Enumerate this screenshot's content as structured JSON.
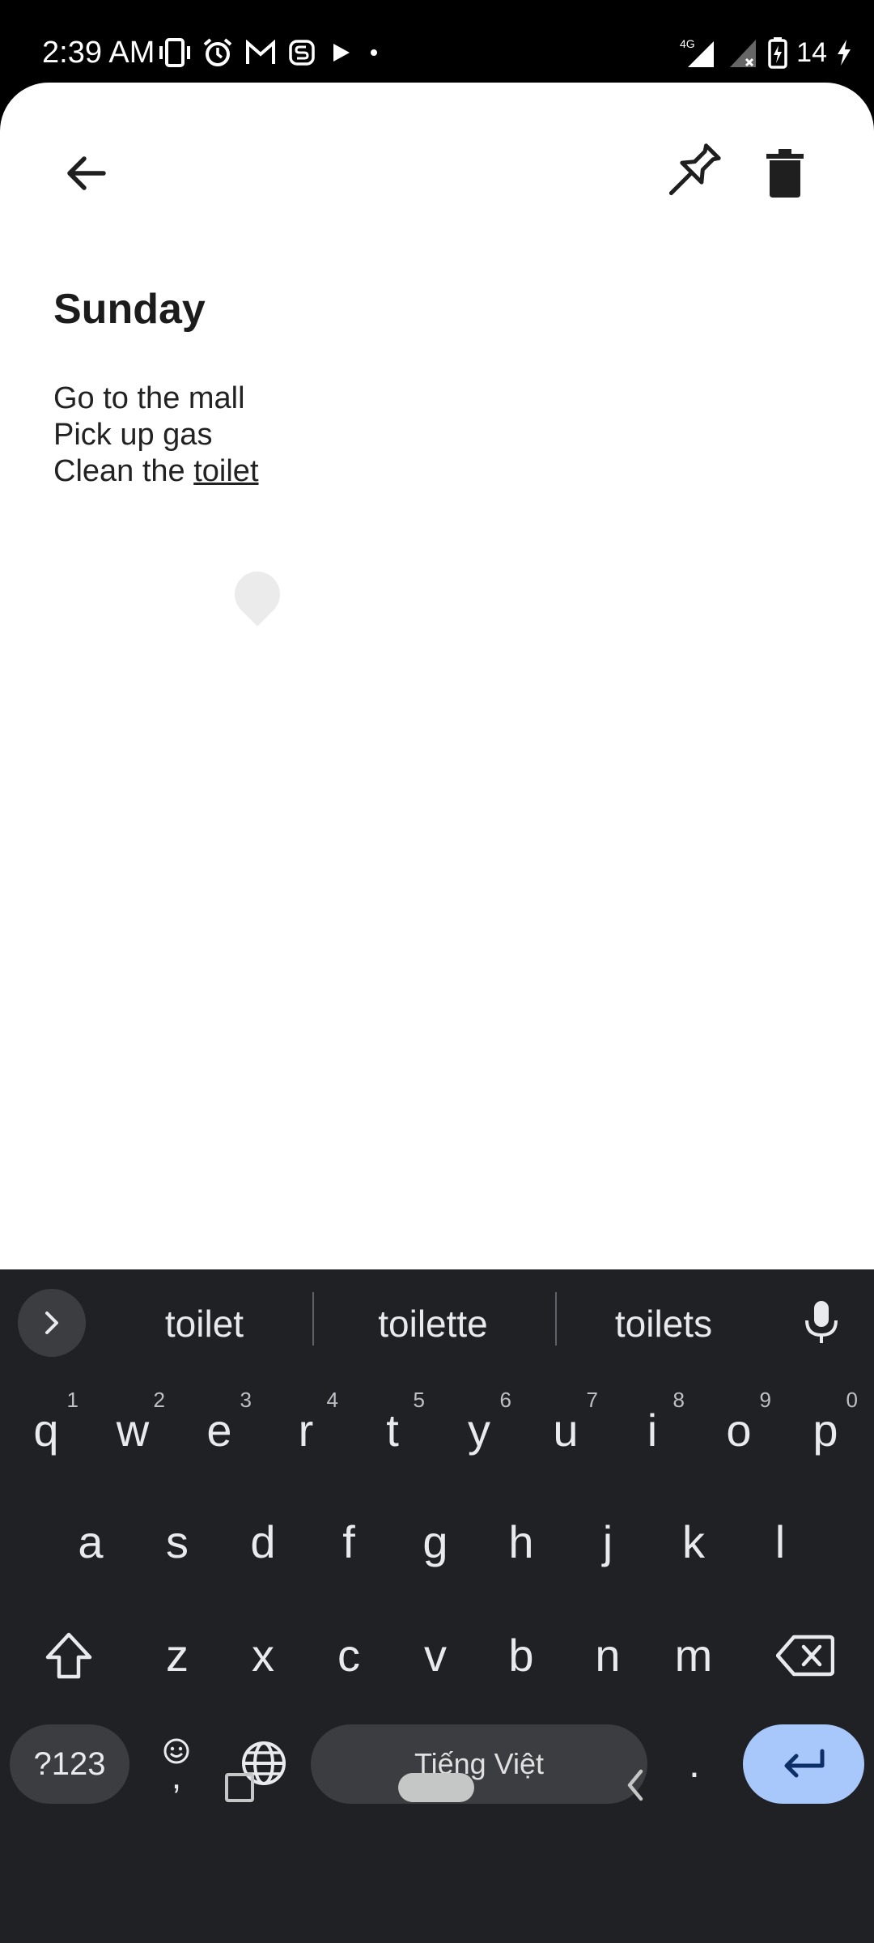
{
  "status_bar": {
    "time": "2:39 AM",
    "left_icons": [
      "vibrate-icon",
      "alarm-icon",
      "gmail-icon",
      "app-s-icon",
      "play-icon",
      "dot-icon"
    ],
    "network": "4G",
    "battery_percent": "14",
    "right_icons": [
      "signal-icon",
      "no-signal-icon",
      "battery-charging-icon",
      "charging-bolt-icon"
    ]
  },
  "toolbar": {
    "back_icon": "arrow-back-icon",
    "pin_icon": "pushpin-icon",
    "delete_icon": "trash-icon"
  },
  "note": {
    "title": "Sunday",
    "lines": [
      "Go to the mall",
      "Pick up gas"
    ],
    "last_line_prefix": "Clean the ",
    "last_line_word": "toilet"
  },
  "keyboard": {
    "suggestions": [
      "toilet",
      "toilette",
      "toilets"
    ],
    "rows": {
      "row1": [
        {
          "key": "q",
          "hint": "1"
        },
        {
          "key": "w",
          "hint": "2"
        },
        {
          "key": "e",
          "hint": "3"
        },
        {
          "key": "r",
          "hint": "4"
        },
        {
          "key": "t",
          "hint": "5"
        },
        {
          "key": "y",
          "hint": "6"
        },
        {
          "key": "u",
          "hint": "7"
        },
        {
          "key": "i",
          "hint": "8"
        },
        {
          "key": "o",
          "hint": "9"
        },
        {
          "key": "p",
          "hint": "0"
        }
      ],
      "row2": [
        "a",
        "s",
        "d",
        "f",
        "g",
        "h",
        "j",
        "k",
        "l"
      ],
      "row3": [
        "z",
        "x",
        "c",
        "v",
        "b",
        "n",
        "m"
      ]
    },
    "symbols_label": "?123",
    "emoji_comma": ",",
    "space_label": "Tiếng Việt",
    "period": ".",
    "enter_color": "#a8c7fa"
  },
  "colors": {
    "keyboard_bg": "#202124",
    "key_text": "#e8eaed",
    "sheet_bg": "#ffffff"
  }
}
